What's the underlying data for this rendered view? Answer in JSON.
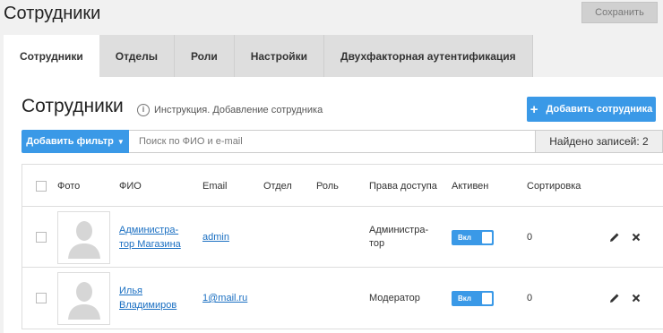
{
  "header": {
    "title": "Сотрудники",
    "save_label": "Сохранить"
  },
  "tabs": [
    {
      "label": "Сотрудники",
      "active": true
    },
    {
      "label": "Отделы",
      "active": false
    },
    {
      "label": "Роли",
      "active": false
    },
    {
      "label": "Настройки",
      "active": false
    },
    {
      "label": "Двухфакторная аутентификация",
      "active": false
    }
  ],
  "section": {
    "title": "Сотрудники",
    "help_text": "Инструкция. Добавление сотрудника",
    "add_label": "Добавить сотрудника"
  },
  "filter": {
    "button_label": "Добавить фильтр",
    "search_placeholder": "Поиск по ФИО и e-mail",
    "found_text": "Найдено записей: 2"
  },
  "table": {
    "columns": {
      "photo": "Фото",
      "name": "ФИО",
      "email": "Email",
      "department": "Отдел",
      "role": "Роль",
      "access": "Права доступа",
      "active": "Активен",
      "sort": "Сортировка"
    },
    "rows": [
      {
        "name_line1": "Администра-",
        "name_line2": "тор Магазина",
        "email": "admin",
        "department": "",
        "role": "",
        "access_line1": "Администра-",
        "access_line2": "тор",
        "active_label": "Вкл",
        "sort": "0"
      },
      {
        "name_line1": "Илья",
        "name_line2": "Владимиров",
        "email": "1@mail.ru",
        "department": "",
        "role": "",
        "access_line1": "Модератор",
        "access_line2": "",
        "active_label": "Вкл",
        "sort": "0"
      }
    ]
  },
  "icons": {
    "help": "info-circle-icon",
    "add": "plus-icon",
    "filter_caret": "caret-down-icon",
    "edit": "pencil-icon",
    "delete": "close-icon",
    "avatar": "avatar-placeholder-icon"
  },
  "colors": {
    "accent": "#3a99e7",
    "link": "#1a6fc2",
    "save_disabled_bg": "#d0d0d0"
  }
}
